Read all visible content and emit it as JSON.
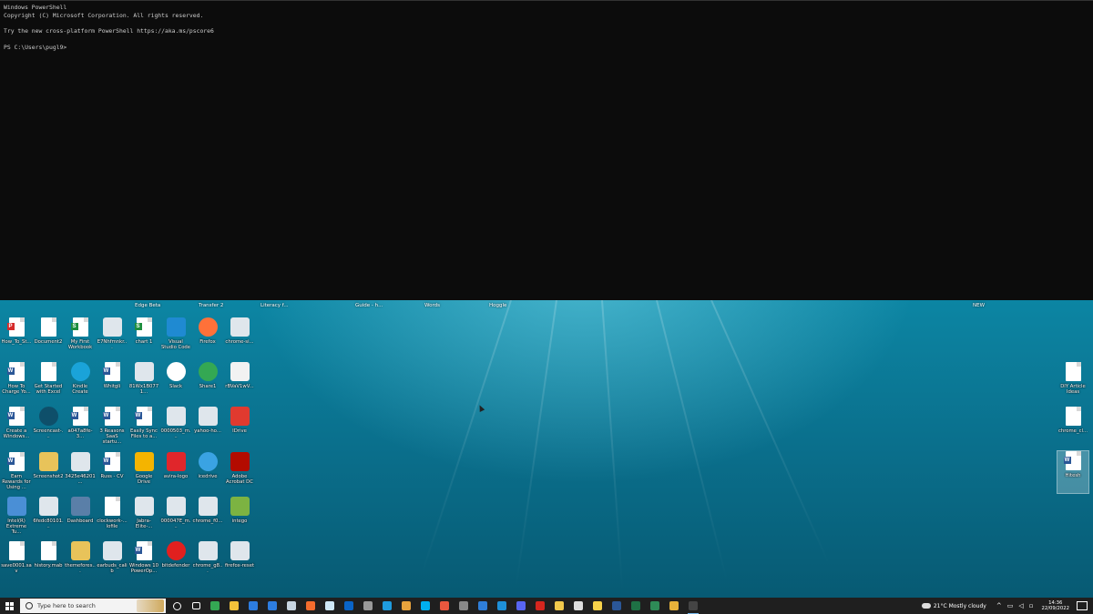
{
  "console": {
    "lines": [
      "Windows PowerShell",
      "Copyright (C) Microsoft Corporation. All rights reserved.",
      "",
      "Try the new cross-platform PowerShell https://aka.ms/pscore6",
      "",
      "PS C:\\Users\\pugl9>"
    ]
  },
  "hidden_labels": [
    "Edge Beta",
    "Transfer 2",
    "Literacy f...",
    "Guide - h...",
    "Words",
    "Hoggle",
    "NEW"
  ],
  "desktop_icons": [
    {
      "label": "How_To_St...",
      "icon": "pdf-icon"
    },
    {
      "label": "Document2",
      "icon": "doc-icon"
    },
    {
      "label": "My First Workbook",
      "icon": "sheet-icon"
    },
    {
      "label": "E7Nhfmnkr...",
      "icon": "image-icon"
    },
    {
      "label": "chart 1",
      "icon": "sheet-icon"
    },
    {
      "label": "Visual Studio Code",
      "icon": "vscode-icon"
    },
    {
      "label": "Firefox",
      "icon": "firefox-icon"
    },
    {
      "label": "chrome-si...",
      "icon": "image-icon"
    },
    {
      "label": "How To Charge Yo...",
      "icon": "word-icon"
    },
    {
      "label": "Get Started with Excel",
      "icon": "doc-icon"
    },
    {
      "label": "Kindle Create",
      "icon": "kindle-icon"
    },
    {
      "label": "Whitgli",
      "icon": "word-icon"
    },
    {
      "label": "81Wx1B0771...",
      "icon": "image-icon"
    },
    {
      "label": "Slack",
      "icon": "slack-icon"
    },
    {
      "label": "Share1",
      "icon": "chrome-icon"
    },
    {
      "label": "rBVaV1wV...",
      "icon": "gamepad-icon"
    },
    {
      "label": "Create a Windows...",
      "icon": "word-icon"
    },
    {
      "label": "Screencast-...",
      "icon": "screencast-icon"
    },
    {
      "label": "a047a8fe-3...",
      "icon": "word-icon"
    },
    {
      "label": "3 Reasons SaaS startu...",
      "icon": "word-icon"
    },
    {
      "label": "Easily Sync Files to a...",
      "icon": "word-icon"
    },
    {
      "label": "0000503_m...",
      "icon": "image-icon"
    },
    {
      "label": "yahoo-ho...",
      "icon": "image-icon"
    },
    {
      "label": "IDrive",
      "icon": "idrive-icon"
    },
    {
      "label": "Earn Rewards for Using ...",
      "icon": "word-icon"
    },
    {
      "label": "Screenshot2",
      "icon": "zip-icon"
    },
    {
      "label": "3425e46201...",
      "icon": "image-icon"
    },
    {
      "label": "Russ - CV",
      "icon": "word-icon"
    },
    {
      "label": "Google Drive",
      "icon": "gdrive-icon"
    },
    {
      "label": "avira-logo",
      "icon": "avira-icon"
    },
    {
      "label": "icedrive",
      "icon": "icedrive-icon"
    },
    {
      "label": "Adobe Acrobat DC",
      "icon": "acrobat-icon"
    },
    {
      "label": "Intel(R) Extreme Tu...",
      "icon": "intel-icon"
    },
    {
      "label": "6fedc80101...",
      "icon": "image-icon"
    },
    {
      "label": "Dashboard",
      "icon": "dashboard-icon"
    },
    {
      "label": "clockwork-... lofile",
      "icon": "doc-icon"
    },
    {
      "label": "Jabra-Elite-...",
      "icon": "image-icon"
    },
    {
      "label": "000047E_m...",
      "icon": "image-icon"
    },
    {
      "label": "chrome_f0...",
      "icon": "image-icon"
    },
    {
      "label": "intego",
      "icon": "intego-icon"
    },
    {
      "label": "save0001.sav",
      "icon": "doc-icon"
    },
    {
      "label": "history.mab",
      "icon": "doc-icon"
    },
    {
      "label": "themefores...",
      "icon": "zip-icon"
    },
    {
      "label": "earbuds_calib",
      "icon": "image-icon"
    },
    {
      "label": "Windows 10 PowerOp...",
      "icon": "word-icon"
    },
    {
      "label": "bitdefender",
      "icon": "bitdefender-icon"
    },
    {
      "label": "chrome_g8...",
      "icon": "image-icon"
    },
    {
      "label": "firefox-reset",
      "icon": "image-icon"
    }
  ],
  "right_icons": [
    {
      "label": "DIY Article Ideas",
      "icon": "doc-icon"
    },
    {
      "label": "chrome_cl...",
      "icon": "doc-icon"
    },
    {
      "label": "Hitesh",
      "icon": "word-icon"
    }
  ],
  "taskbar": {
    "search_placeholder": "Type here to search",
    "apps": [
      "cortana-icon",
      "task-view-icon",
      "chrome-icon",
      "file-explorer-icon",
      "calendar-icon",
      "mail-icon",
      "steam-icon",
      "origin-icon",
      "notepad-icon",
      "cloud-icon",
      "tool-icon",
      "edge-icon",
      "gallery-icon",
      "skype-icon",
      "snip-icon",
      "calculator-icon",
      "todo-icon",
      "photos-icon",
      "discord-icon",
      "acrobat-icon",
      "pen-icon",
      "g-icon",
      "sticky-notes-icon",
      "word-icon",
      "excel-icon",
      "edge-beta-icon",
      "chrome-canary-icon",
      "terminal-icon"
    ],
    "weather": "21°C  Mostly cloudy",
    "time": "14:36",
    "date": "22/09/2022"
  },
  "colors": {
    "console_bg": "#0c0c0c",
    "console_text": "#cccccc",
    "taskbar_bg": "#1f1f1f",
    "wallpaper": "#0d8aa8"
  }
}
